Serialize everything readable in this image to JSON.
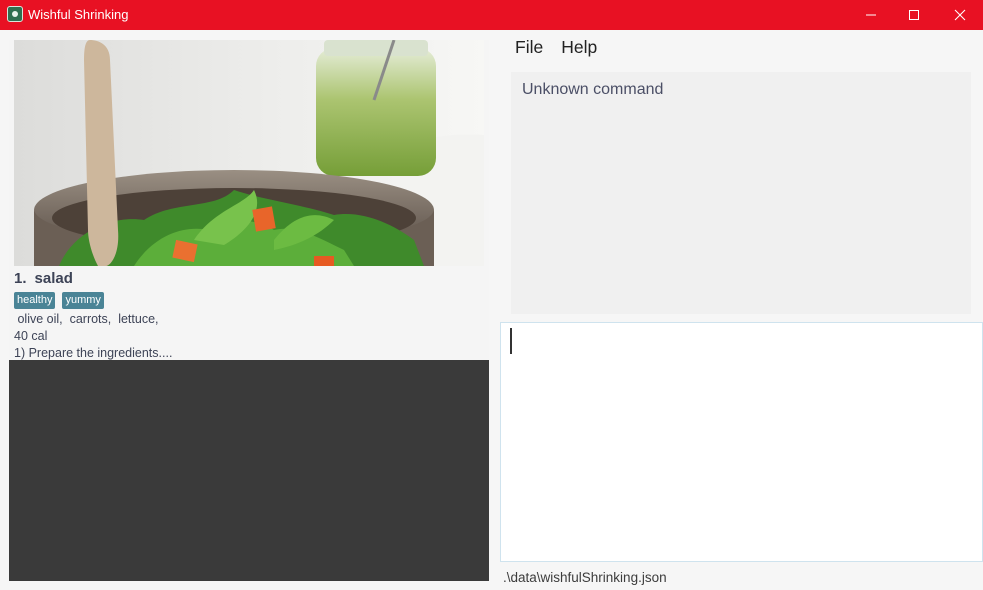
{
  "window": {
    "title": "Wishful Shrinking",
    "accent_color": "#e81123"
  },
  "recipe_list": {
    "items": [
      {
        "index": "1.",
        "name": "salad",
        "image": "salad-bowl-photo",
        "tags": [
          "healthy",
          "yummy"
        ],
        "ingredients": " olive oil,  carrots,  lettuce,",
        "calories": "40 cal",
        "instructions": "1) Prepare the ingredients...."
      }
    ]
  },
  "menu": {
    "file_label": "File",
    "help_label": "Help"
  },
  "result_display": {
    "text": "Unknown command"
  },
  "command_box": {
    "value": ""
  },
  "status_bar": {
    "save_location": ".\\data\\wishfulShrinking.json"
  }
}
